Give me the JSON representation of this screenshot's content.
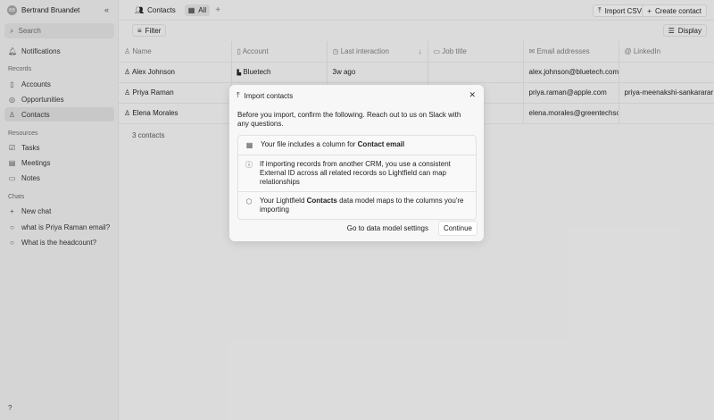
{
  "sidebar": {
    "user": "Bertrand Bruandet",
    "initials": "BB",
    "search": "Search",
    "notifications": "Notifications",
    "records_label": "Records",
    "records": [
      "Accounts",
      "Opportunities",
      "Contacts"
    ],
    "resources_label": "Resources",
    "resources": [
      "Tasks",
      "Meetings",
      "Notes"
    ],
    "chats_label": "Chats",
    "chats": [
      "New chat",
      "what is Priya Raman email?",
      "What is the headcount?"
    ],
    "help": "?"
  },
  "topbar": {
    "tab_contacts": "Contacts",
    "tab_all": "All",
    "add": "+",
    "import_csv": "Import CSV",
    "create_contact": "Create contact"
  },
  "toolbar": {
    "filter": "Filter",
    "display": "Display"
  },
  "table": {
    "columns": [
      "Name",
      "Account",
      "Last interaction",
      "Job title",
      "Email addresses",
      "LinkedIn"
    ],
    "rows": [
      {
        "name": "Alex Johnson",
        "account": "Bluetech",
        "last": "3w ago",
        "job": "",
        "email": "alex.johnson@bluetech.com",
        "linkedin": ""
      },
      {
        "name": "Priya Raman",
        "account": "",
        "last": "",
        "job": "",
        "email": "priya.raman@apple.com",
        "linkedin": "priya-meenakshi-sankararar"
      },
      {
        "name": "Elena Morales",
        "account": "",
        "last": "",
        "job": "",
        "email": "elena.morales@greentechsol",
        "linkedin": ""
      }
    ],
    "count": "3 contacts"
  },
  "modal": {
    "title": "Import contacts",
    "description": "Before you import, confirm the following. Reach out to us on Slack with any questions.",
    "item1_pre": "Your file includes a column for ",
    "item1_bold": "Contact email",
    "item2": "If importing records from another CRM, you use a consistent External ID across all related records so Lightfield can map relationships",
    "item3_pre": "Your Lightfield ",
    "item3_bold": "Contacts",
    "item3_post": " data model maps to the columns you're importing",
    "settings": "Go to data model settings",
    "continue": "Continue"
  }
}
